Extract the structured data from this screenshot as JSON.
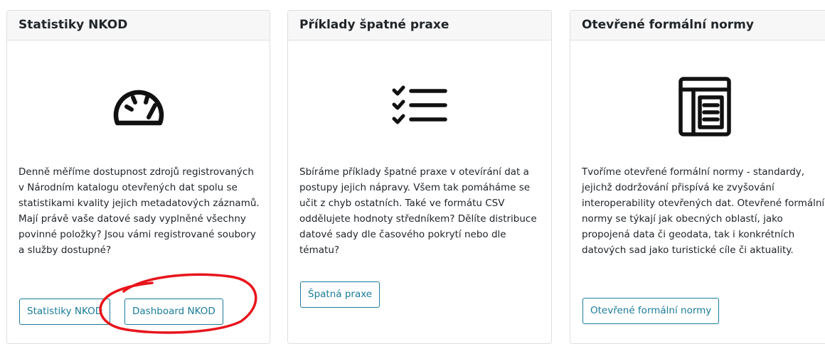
{
  "cards": [
    {
      "title": "Statistiky NKOD",
      "icon": "speedometer-icon",
      "text": "Denně měříme dostupnost zdrojů registrovaných v Národním katalogu otevřených dat spolu se statistikami kvality jejich metadatových záznamů. Mají právě vaše datové sady vyplněné všechny povinné položky? Jsou vámi registrované soubory a služby dostupné?",
      "buttons": [
        "Statistiky NKOD",
        "Dashboard NKOD"
      ]
    },
    {
      "title": "Příklady špatné praxe",
      "icon": "checklist-icon",
      "text": "Sbíráme příklady špatné praxe v otevírání dat a postupy jejich nápravy. Všem tak pomáháme se učit z chyb ostatních. Také ve formátu CSV oddělujete hodnoty středníkem? Dělíte distribuce datové sady dle časového pokrytí nebo dle tématu?",
      "buttons": [
        "Špatná praxe"
      ]
    },
    {
      "title": "Otevřené formální normy",
      "icon": "document-layout-icon",
      "text": "Tvoříme otevřené formální normy - standardy, jejichž dodržování přispívá ke zvyšování interoperability otevřených dat. Otevřené formální normy se týkají jak obecných oblastí, jako propojená data či geodata, tak i konkrétních datových sad jako turistické cíle či aktuality.",
      "buttons": [
        "Otevřené formální normy"
      ]
    }
  ],
  "colors": {
    "button": "#1b7c9a",
    "annotation": "#e8141c",
    "border": "#dfdfdf"
  }
}
